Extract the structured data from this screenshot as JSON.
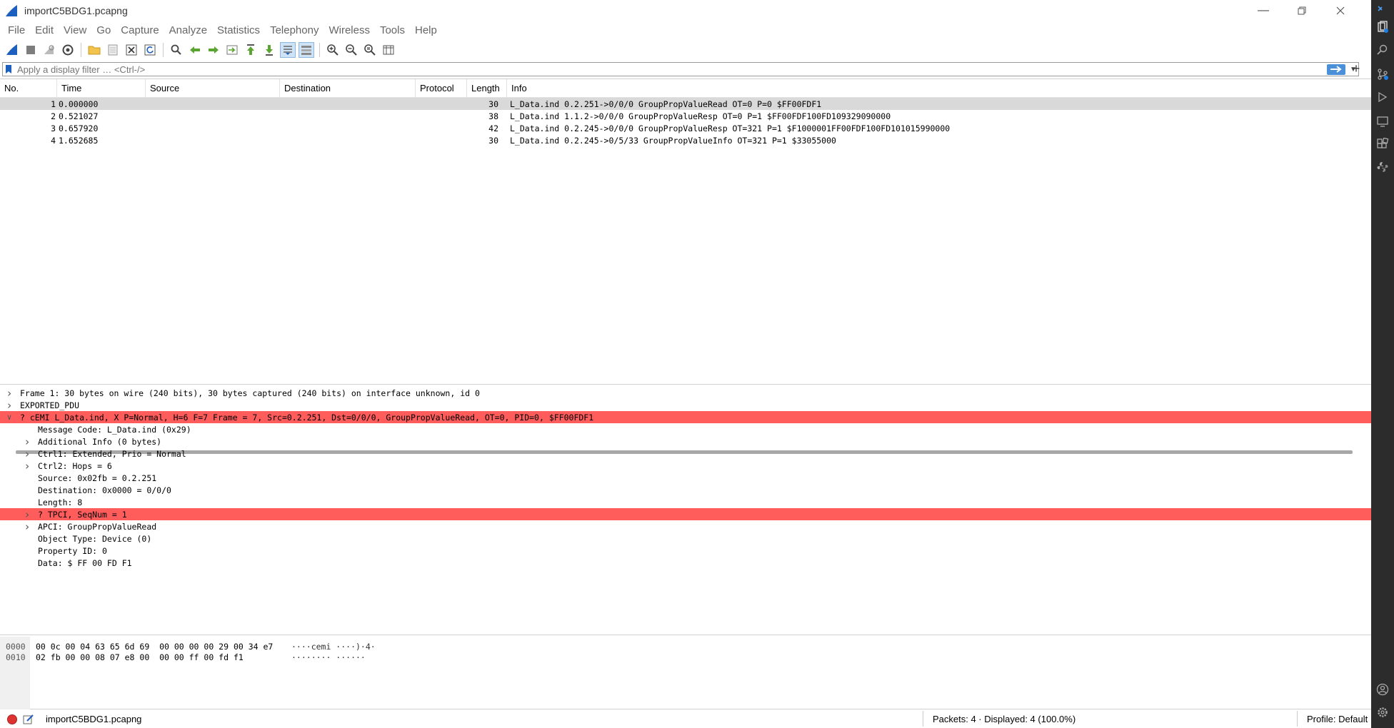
{
  "window": {
    "title": "importC5BDG1.pcapng"
  },
  "menu": [
    "File",
    "Edit",
    "View",
    "Go",
    "Capture",
    "Analyze",
    "Statistics",
    "Telephony",
    "Wireless",
    "Tools",
    "Help"
  ],
  "filter": {
    "placeholder": "Apply a display filter … <Ctrl-/>",
    "plus": "+"
  },
  "packet_list": {
    "columns": [
      "No.",
      "Time",
      "Source",
      "Destination",
      "Protocol",
      "Length",
      "Info"
    ],
    "rows": [
      {
        "no": "1",
        "time": "0.000000",
        "source": "",
        "destination": "",
        "protocol": "",
        "length": "30",
        "info": "L_Data.ind 0.2.251->0/0/0 GroupPropValueRead OT=0 P=0 $FF00FDF1"
      },
      {
        "no": "2",
        "time": "0.521027",
        "source": "",
        "destination": "",
        "protocol": "",
        "length": "38",
        "info": "L_Data.ind 1.1.2->0/0/0 GroupPropValueResp OT=0 P=1 $FF00FDF100FD109329090000"
      },
      {
        "no": "3",
        "time": "0.657920",
        "source": "",
        "destination": "",
        "protocol": "",
        "length": "42",
        "info": "L_Data.ind 0.2.245->0/0/0 GroupPropValueResp OT=321 P=1 $F1000001FF00FDF100FD101015990000"
      },
      {
        "no": "4",
        "time": "1.652685",
        "source": "",
        "destination": "",
        "protocol": "",
        "length": "30",
        "info": "L_Data.ind 0.2.245->0/5/33 GroupPropValueInfo OT=321 P=1 $33055000"
      }
    ]
  },
  "details": [
    {
      "text": "Frame 1: 30 bytes on wire (240 bits), 30 bytes captured (240 bits) on interface unknown, id 0",
      "level": 0,
      "arrow": "right",
      "error": false
    },
    {
      "text": "EXPORTED_PDU",
      "level": 0,
      "arrow": "right",
      "error": false
    },
    {
      "text": "? cEMI L_Data.ind, X P=Normal, H=6 F=7 Frame = 7, Src=0.2.251, Dst=0/0/0, GroupPropValueRead, OT=0, PID=0, $FF00FDF1",
      "level": 0,
      "arrow": "down",
      "error": true
    },
    {
      "text": "Message Code: L_Data.ind (0x29)",
      "level": 1,
      "arrow": "",
      "error": false
    },
    {
      "text": "Additional Info (0 bytes)",
      "level": 1,
      "arrow": "right",
      "error": false
    },
    {
      "text": "Ctrl1: Extended, Prio = Normal",
      "level": 1,
      "arrow": "right",
      "error": false
    },
    {
      "text": "Ctrl2: Hops = 6",
      "level": 1,
      "arrow": "right",
      "error": false
    },
    {
      "text": "Source: 0x02fb = 0.2.251",
      "level": 1,
      "arrow": "",
      "error": false
    },
    {
      "text": "Destination: 0x0000 = 0/0/0",
      "level": 1,
      "arrow": "",
      "error": false
    },
    {
      "text": "Length: 8",
      "level": 1,
      "arrow": "",
      "error": false
    },
    {
      "text": "? TPCI, SeqNum = 1",
      "level": 1,
      "arrow": "right",
      "error": true
    },
    {
      "text": "APCI: GroupPropValueRead",
      "level": 1,
      "arrow": "right",
      "error": false
    },
    {
      "text": "Object Type: Device (0)",
      "level": 1,
      "arrow": "",
      "error": false
    },
    {
      "text": "Property ID: 0",
      "level": 1,
      "arrow": "",
      "error": false
    },
    {
      "text": "Data: $ FF 00 FD F1",
      "level": 1,
      "arrow": "",
      "error": false
    }
  ],
  "bytes": [
    {
      "offset": "0000",
      "hex": "00 0c 00 04 63 65 6d 69  00 00 00 00 29 00 34 e7",
      "ascii": "····cemi ····)·4·"
    },
    {
      "offset": "0010",
      "hex": "02 fb 00 00 08 07 e8 00  00 00 ff 00 fd f1",
      "ascii": "········ ······"
    }
  ],
  "status": {
    "file": "importC5BDG1.pcapng",
    "packets": "Packets: 4 · Displayed: 4 (100.0%)",
    "profile": "Profile: Default"
  },
  "colors": {
    "error_row": "#ff5c5c",
    "selected_row": "#d9d9d9",
    "sidestrip": "#2c2c2c",
    "accent": "#1c5fbf"
  }
}
